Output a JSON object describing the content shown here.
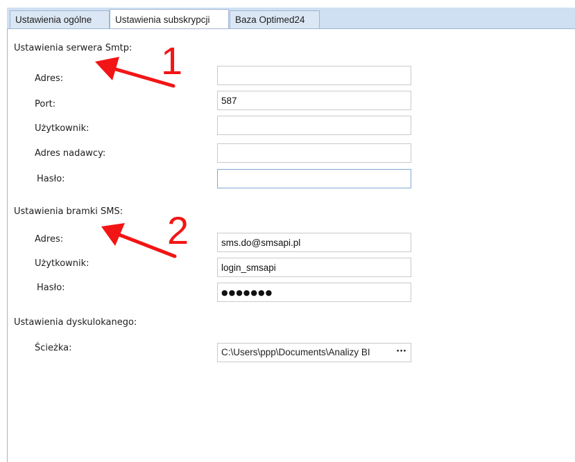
{
  "tabs": [
    {
      "label": "Ustawienia ogólne"
    },
    {
      "label": "Ustawienia subskrypcji"
    },
    {
      "label": "Baza Optimed24"
    }
  ],
  "smtp": {
    "heading": "Ustawienia serwera Smtp:",
    "address_label": "Adres:",
    "address_value": "",
    "port_label": "Port:",
    "port_value": "587",
    "user_label": "Użytkownik:",
    "user_value": "",
    "sender_label": "Adres nadawcy:",
    "sender_value": "",
    "password_label": "Hasło:",
    "password_value": ""
  },
  "sms": {
    "heading": "Ustawienia bramki SMS:",
    "address_label": "Adres:",
    "address_value": "sms.do@smsapi.pl",
    "user_label": "Użytkownik:",
    "user_value": "login_smsapi",
    "password_label": "Hasło:",
    "password_value": "●●●●●●●"
  },
  "disk": {
    "heading": "Ustawienia dyskulokanego:",
    "path_label": "Ścieżka:",
    "path_value": "C:\\Users\\ppp\\Documents\\Analizy BI",
    "browse_label": "···"
  },
  "annotations": {
    "one": "1",
    "two": "2",
    "color": "#f21515"
  }
}
